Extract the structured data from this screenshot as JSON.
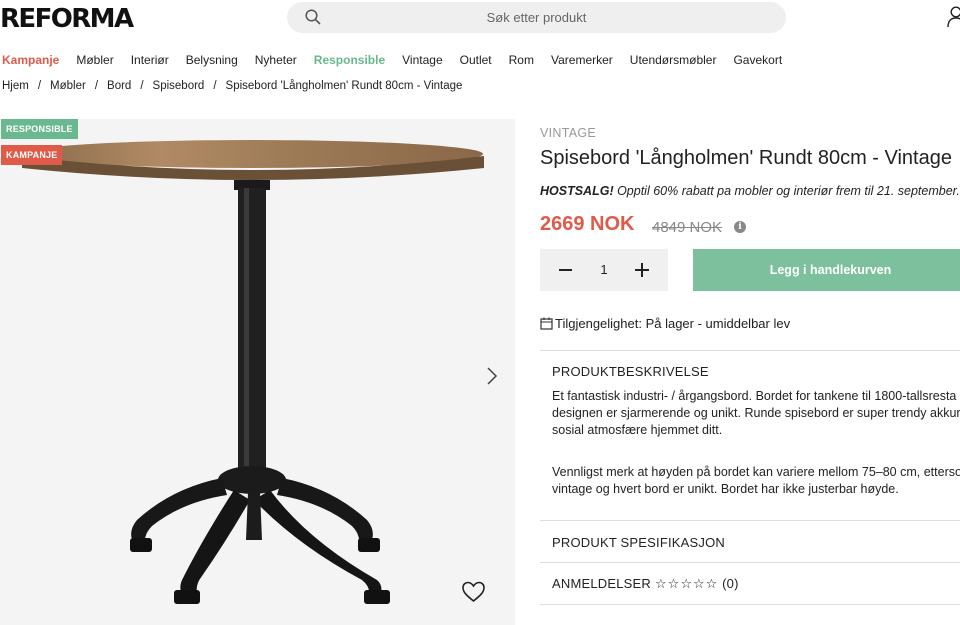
{
  "header": {
    "logo": "REFORMA",
    "search_placeholder": "Søk etter produkt"
  },
  "nav": {
    "items": [
      "Kampanje",
      "Møbler",
      "Interiør",
      "Belysning",
      "Nyheter",
      "Responsible",
      "Vintage",
      "Outlet",
      "Rom",
      "Varemerker",
      "Utendørsmøbler",
      "Gavekort"
    ]
  },
  "breadcrumb": [
    "Hjem",
    "Møbler",
    "Bord",
    "Spisebord",
    "Spisebord 'Långholmen' Rundt 80cm - Vintage"
  ],
  "badges": {
    "responsible": "RESPONSIBLE",
    "kampanje": "KAMPANJE"
  },
  "product": {
    "brand": "VINTAGE",
    "title": "Spisebord 'Långholmen' Rundt 80cm - Vintage",
    "promo_bold": "HOSTSALG!",
    "promo_text": " Opptil 60% rabatt pa mobler og interiør frem til 21. september.",
    "price": "2669 NOK",
    "old_price": "4849 NOK",
    "quantity": "1",
    "add_to_cart": "Legg i handlekurven",
    "availability": "Tilgjengelighet: På lager - umiddelbar lev"
  },
  "sections": {
    "description_title": "PRODUKTBESKRIVELSE",
    "description_p1": "Et fantastisk industri- / årgangsbord. Bordet for tankene til 1800-tallsresta\ndesignen er sjarmerende og unikt. Runde spisebord er super trendy akkura\nsosial atmosfære hjemmet ditt.",
    "description_p2": "Vennligst merk at høyden på bordet kan variere mellom 75–80 cm, etterso\nvintage og hvert bord er unikt. Bordet har ikke justerbar høyde.",
    "spec_title": "PRODUKT SPESIFIKASJON",
    "reviews_title": "ANMELDELSER",
    "reviews_stars": "☆☆☆☆☆",
    "reviews_count": "(0)"
  },
  "colors": {
    "accent_red": "#e05a4a",
    "accent_green": "#6ab88f",
    "cart_button": "#7cc09e"
  }
}
